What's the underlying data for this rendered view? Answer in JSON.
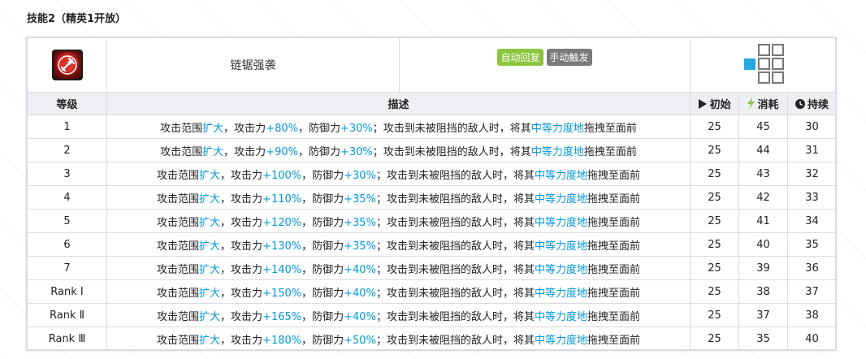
{
  "section_title": "技能2（精英1开放）",
  "skill": {
    "name": "链锯强袭",
    "tags": {
      "auto": "自动回复",
      "manual": "手动触发"
    }
  },
  "colors": {
    "auto_tag": "#8cc53f",
    "manual_tag": "#7a7a7a",
    "highlight": "#0098dc",
    "range_self": "#27a8e0"
  },
  "headers": {
    "level": "等级",
    "desc": "描述",
    "initial": "初始",
    "cost": "消耗",
    "duration": "持续"
  },
  "desc_parts": {
    "p1": "攻击范围",
    "h1": "扩大",
    "p2": "，攻击力",
    "p3": "，防御力",
    "p4": "；攻击到未被阻挡的敌人时，将其",
    "h4": "中等力度地",
    "p5": "拖拽至面前"
  },
  "rows": [
    {
      "level": "1",
      "atk": "+80%",
      "def": "+30%",
      "initial": "25",
      "cost": "45",
      "duration": "30"
    },
    {
      "level": "2",
      "atk": "+90%",
      "def": "+30%",
      "initial": "25",
      "cost": "44",
      "duration": "31"
    },
    {
      "level": "3",
      "atk": "+100%",
      "def": "+30%",
      "initial": "25",
      "cost": "43",
      "duration": "32"
    },
    {
      "level": "4",
      "atk": "+110%",
      "def": "+35%",
      "initial": "25",
      "cost": "42",
      "duration": "33"
    },
    {
      "level": "5",
      "atk": "+120%",
      "def": "+35%",
      "initial": "25",
      "cost": "41",
      "duration": "34"
    },
    {
      "level": "6",
      "atk": "+130%",
      "def": "+35%",
      "initial": "25",
      "cost": "40",
      "duration": "35"
    },
    {
      "level": "7",
      "atk": "+140%",
      "def": "+40%",
      "initial": "25",
      "cost": "39",
      "duration": "36"
    },
    {
      "level": "Rank Ⅰ",
      "atk": "+150%",
      "def": "+40%",
      "initial": "25",
      "cost": "38",
      "duration": "37"
    },
    {
      "level": "Rank Ⅱ",
      "atk": "+165%",
      "def": "+40%",
      "initial": "25",
      "cost": "37",
      "duration": "38"
    },
    {
      "level": "Rank Ⅲ",
      "atk": "+180%",
      "def": "+50%",
      "initial": "25",
      "cost": "35",
      "duration": "40"
    }
  ]
}
